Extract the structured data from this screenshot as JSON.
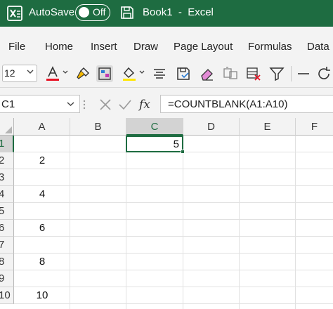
{
  "titlebar": {
    "autosave_label": "AutoSave",
    "autosave_state": "Off",
    "title": "Book1  -  Excel"
  },
  "menu": {
    "tabs": [
      "File",
      "Home",
      "Insert",
      "Draw",
      "Page Layout",
      "Formulas",
      "Data"
    ]
  },
  "toolbar": {
    "font_size": "12",
    "font_color": "#e81123",
    "fill_color": "#ffe600",
    "icons": [
      "font-color-icon",
      "format-painter-icon",
      "styles-icon",
      "fill-color-icon",
      "align-icon",
      "save-icon",
      "eraser-icon",
      "copy-format-icon",
      "clear-filter-icon",
      "filter-icon",
      "more-icon",
      "refresh-icon"
    ]
  },
  "formula_bar": {
    "name_box": "C1",
    "formula": "=COUNTBLANK(A1:A10)"
  },
  "grid": {
    "columns": [
      "A",
      "B",
      "C",
      "D",
      "E",
      "F"
    ],
    "rows": [
      "1",
      "2",
      "3",
      "4",
      "5",
      "6",
      "7",
      "8",
      "9",
      "10"
    ],
    "column_a_values": [
      "",
      "2",
      "",
      "4",
      "",
      "6",
      "",
      "8",
      "",
      "10"
    ],
    "selected_cell": "C1",
    "selected_value": "5"
  },
  "colors": {
    "excel_green": "#1e6c41",
    "ribbon_bg": "#f3f3f3"
  }
}
